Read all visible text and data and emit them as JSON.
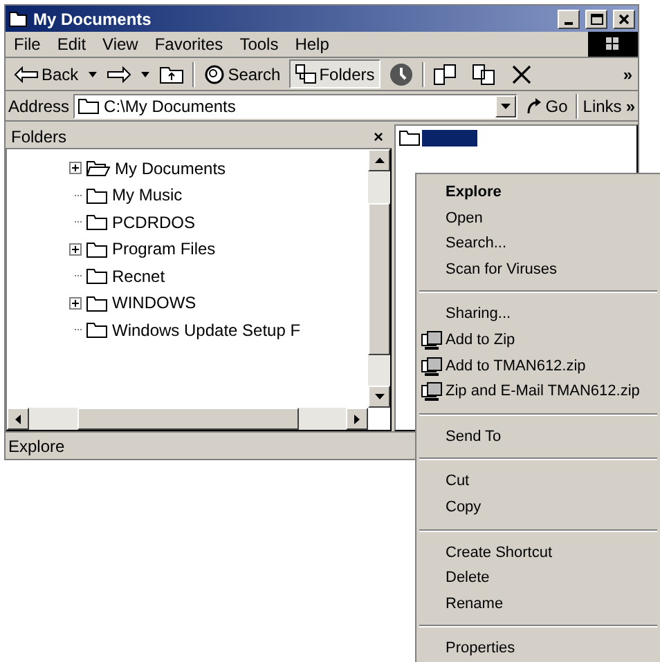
{
  "window": {
    "title": "My Documents"
  },
  "menu_bar": [
    "File",
    "Edit",
    "View",
    "Favorites",
    "Tools",
    "Help"
  ],
  "toolbar": [
    {
      "kind": "back",
      "label": "Back",
      "selected": false
    },
    {
      "kind": "forward",
      "selected": false
    },
    {
      "kind": "up",
      "selected": false
    },
    {
      "kind": "search",
      "label": "Search",
      "selected": false
    },
    {
      "kind": "folders",
      "label": "Folders",
      "selected": true
    },
    {
      "kind": "history",
      "selected": false
    },
    {
      "kind": "move",
      "selected": false
    },
    {
      "kind": "copy",
      "selected": false
    },
    {
      "kind": "delete",
      "selected": false
    }
  ],
  "toolbar_more": "»",
  "address_bar": {
    "label": "Address",
    "value": "C:\\My Documents",
    "go": "Go",
    "links": "Links",
    "more": "»"
  },
  "folders_pane": {
    "title": "Folders",
    "close": "×",
    "items": [
      {
        "label": "My Documents",
        "expandable": true,
        "open": true
      },
      {
        "label": "My Music",
        "expandable": false,
        "open": false
      },
      {
        "label": "PCDRDOS",
        "expandable": false,
        "open": false
      },
      {
        "label": "Program Files",
        "expandable": true,
        "open": false
      },
      {
        "label": "Recnet",
        "expandable": false,
        "open": false
      },
      {
        "label": "WINDOWS",
        "expandable": true,
        "open": false
      },
      {
        "label": "Windows Update Setup F",
        "expandable": false,
        "open": false
      }
    ]
  },
  "status_bar": "Explore",
  "context_menu": [
    {
      "kind": "default",
      "label": "Explore"
    },
    {
      "kind": "item",
      "label": "Open"
    },
    {
      "kind": "item",
      "label": "Search..."
    },
    {
      "kind": "item",
      "label": "Scan for Viruses"
    },
    {
      "kind": "separator"
    },
    {
      "kind": "item",
      "label": "Sharing..."
    },
    {
      "kind": "zip",
      "label": "Add to Zip"
    },
    {
      "kind": "zip",
      "label": "Add to TMAN612.zip"
    },
    {
      "kind": "zip",
      "label": "Zip and E-Mail TMAN612.zip"
    },
    {
      "kind": "separator"
    },
    {
      "kind": "item",
      "label": "Send To"
    },
    {
      "kind": "separator"
    },
    {
      "kind": "item",
      "label": "Cut"
    },
    {
      "kind": "item",
      "label": "Copy"
    },
    {
      "kind": "separator"
    },
    {
      "kind": "item",
      "label": "Create Shortcut"
    },
    {
      "kind": "item",
      "label": "Delete"
    },
    {
      "kind": "item",
      "label": "Rename"
    },
    {
      "kind": "separator"
    },
    {
      "kind": "item",
      "label": "Properties"
    }
  ]
}
